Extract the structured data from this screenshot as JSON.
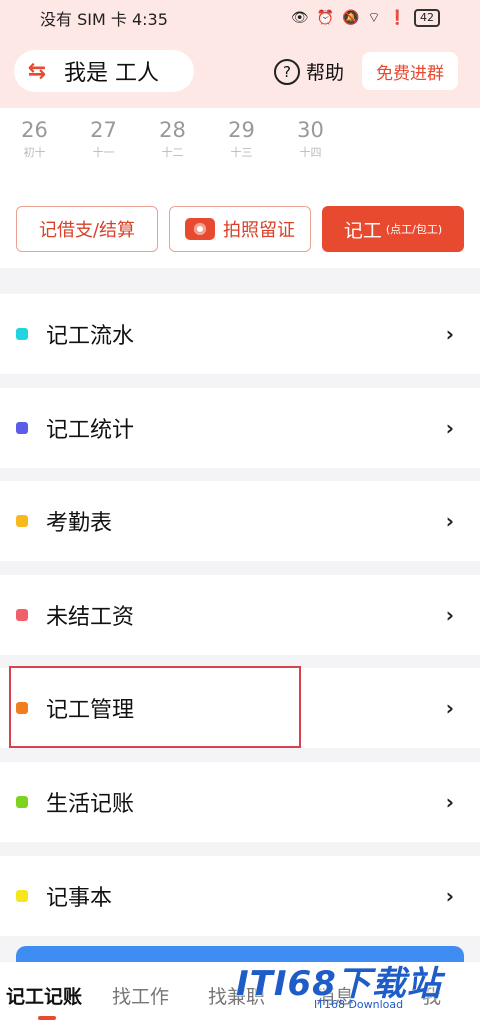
{
  "status_bar": {
    "carrier_time": "没有 SIM 卡 4:35",
    "battery": "42"
  },
  "header": {
    "role_label": "我是 工人",
    "help_label": "帮助",
    "join_button": "免费进群"
  },
  "calendar": {
    "days": [
      {
        "num": "26",
        "lunar": "初十"
      },
      {
        "num": "27",
        "lunar": "十一"
      },
      {
        "num": "28",
        "lunar": "十二"
      },
      {
        "num": "29",
        "lunar": "十三"
      },
      {
        "num": "30",
        "lunar": "十四"
      }
    ]
  },
  "actions": {
    "borrow_settle": "记借支/结算",
    "photo_record": "拍照留证",
    "record_work": "记工",
    "record_work_sub": "(点工/包工)"
  },
  "menu": [
    {
      "label": "记工流水",
      "color": "#22d3e0"
    },
    {
      "label": "记工统计",
      "color": "#5b5de8"
    },
    {
      "label": "考勤表",
      "color": "#f7b91e"
    },
    {
      "label": "未结工资",
      "color": "#f0606a"
    },
    {
      "label": "记工管理",
      "color": "#f07d1e"
    },
    {
      "label": "生活记账",
      "color": "#7ed321"
    },
    {
      "label": "记事本",
      "color": "#f5e61e"
    }
  ],
  "tabs": {
    "t1": "记工记账",
    "t2": "找工作",
    "t3": "找兼职",
    "t4": "消息",
    "t5": "我"
  },
  "watermark": {
    "logo": "ITI68下载站",
    "sub": "IT168 Download"
  },
  "colors": {
    "accent": "#e84a30",
    "header_bg": "#fde8e5",
    "highlight": "#d9414c"
  }
}
